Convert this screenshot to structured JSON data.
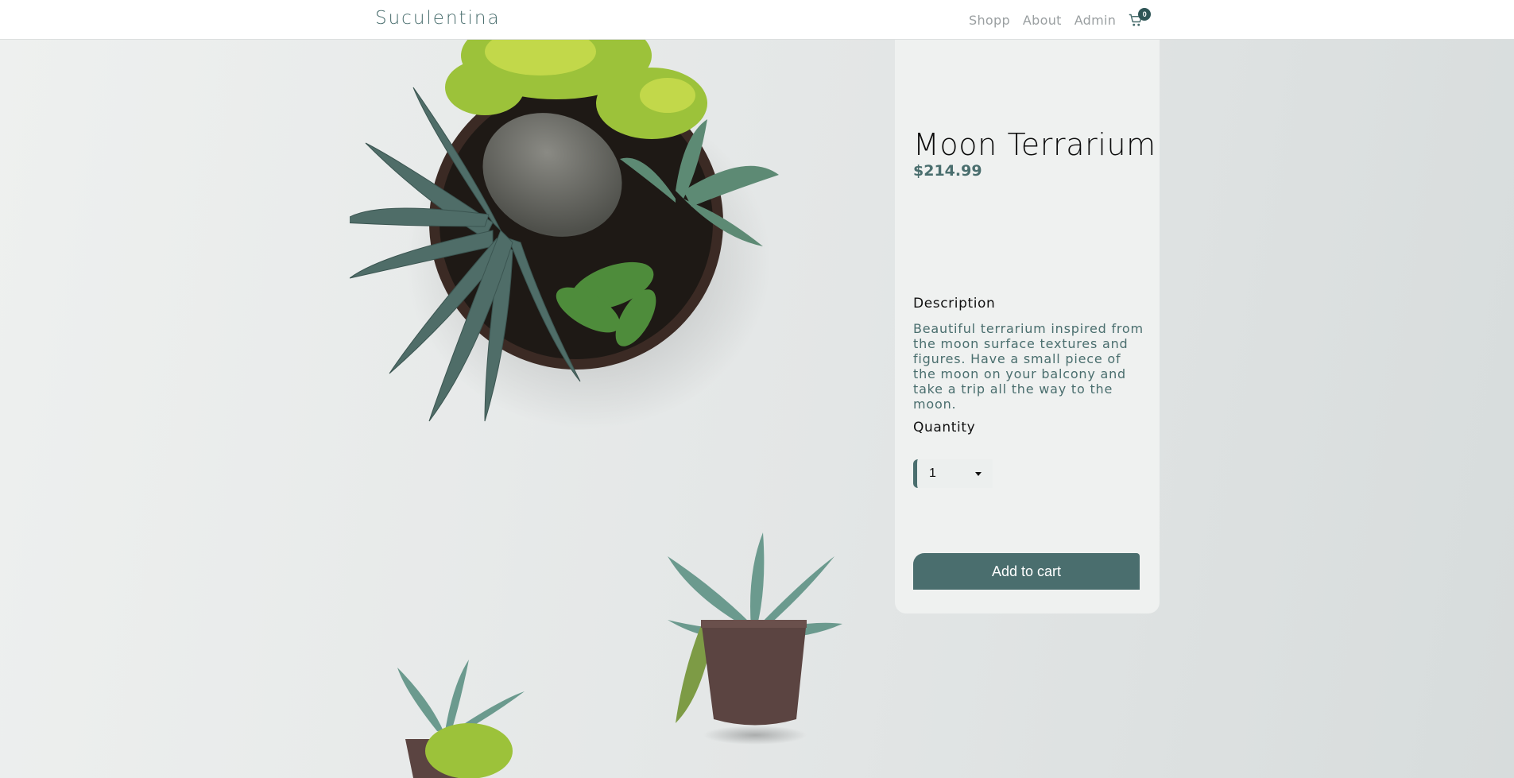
{
  "navbar": {
    "logo": "Suculentina",
    "links": [
      "Shopp",
      "About",
      "Admin"
    ],
    "cart_count": "0"
  },
  "product": {
    "title": "Moon Terrarium",
    "price": "$214.99",
    "description_label": "Description",
    "description": "Beautiful terrarium inspired from the moon surface textures and figures. Have a small piece of the moon on your balcony and take a trip all the way to the moon.",
    "quantity_label": "Quantity",
    "quantity_value": "1",
    "add_to_cart_label": "Add to cart"
  },
  "icons": {
    "cart": "shopping-cart-icon",
    "caret": "caret-down-icon"
  },
  "colors": {
    "accent": "#4a6e6e",
    "nav_link": "#9a9fa1",
    "badge": "#2f5556"
  }
}
